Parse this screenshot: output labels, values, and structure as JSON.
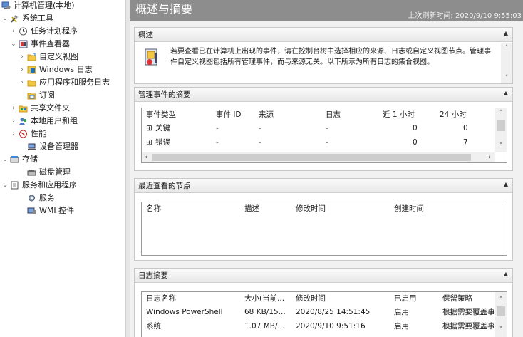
{
  "tree": {
    "items": [
      {
        "label": "计算机管理(本地)",
        "icon": "computer-management-icon"
      },
      {
        "label": "系统工具",
        "icon": "system-tools-icon"
      },
      {
        "label": "任务计划程序",
        "icon": "task-scheduler-icon"
      },
      {
        "label": "事件查看器",
        "icon": "event-viewer-icon"
      },
      {
        "label": "自定义视图",
        "icon": "folder-icon"
      },
      {
        "label": "Windows 日志",
        "icon": "windows-logs-icon"
      },
      {
        "label": "应用程序和服务日志",
        "icon": "folder-icon"
      },
      {
        "label": "订阅",
        "icon": "subscriptions-icon"
      },
      {
        "label": "共享文件夹",
        "icon": "shared-folders-icon"
      },
      {
        "label": "本地用户和组",
        "icon": "users-groups-icon"
      },
      {
        "label": "性能",
        "icon": "performance-icon"
      },
      {
        "label": "设备管理器",
        "icon": "device-manager-icon"
      },
      {
        "label": "存储",
        "icon": "storage-icon"
      },
      {
        "label": "磁盘管理",
        "icon": "disk-management-icon"
      },
      {
        "label": "服务和应用程序",
        "icon": "services-apps-icon"
      },
      {
        "label": "服务",
        "icon": "services-icon"
      },
      {
        "label": "WMI 控件",
        "icon": "wmi-icon"
      }
    ]
  },
  "header": {
    "title": "概述与摘要",
    "refresh": "上次刷新时间: 2020/9/10 9:55:03"
  },
  "overview": {
    "title": "概述",
    "text": "若要查看已在计算机上出现的事件，请在控制台树中选择相应的来源、日志或自定义视图节点。管理事件自定义视图包括所有管理事件，而与来源无关。以下所示为所有日志的集合视图。"
  },
  "summary": {
    "title": "管理事件的摘要",
    "columns": [
      "事件类型",
      "事件 ID",
      "来源",
      "日志",
      "近 1 小时",
      "24 小时"
    ],
    "rows": [
      [
        "关键",
        "-",
        "-",
        "-",
        "0",
        "0"
      ],
      [
        "错误",
        "-",
        "-",
        "-",
        "0",
        "7"
      ]
    ],
    "expand_glyph": "⊞"
  },
  "recent": {
    "title": "最近查看的节点",
    "columns": [
      "名称",
      "描述",
      "修改时间",
      "创建时间"
    ]
  },
  "logsummary": {
    "title": "日志摘要",
    "columns": [
      "日志名称",
      "大小(当前...",
      "修改时间",
      "已启用",
      "保留策略"
    ],
    "rows": [
      [
        "Windows PowerShell",
        "68 KB/15...",
        "2020/8/25 14:51:45",
        "启用",
        "根据需要覆盖事"
      ],
      [
        "系统",
        "1.07 MB/...",
        "2020/9/10 9:51:16",
        "启用",
        "根据需要覆盖事"
      ]
    ]
  },
  "colors": {
    "header_bg": "#8d8d8d",
    "pane_bg": "#f1f1f1",
    "section_border": "#c8c8c8"
  }
}
